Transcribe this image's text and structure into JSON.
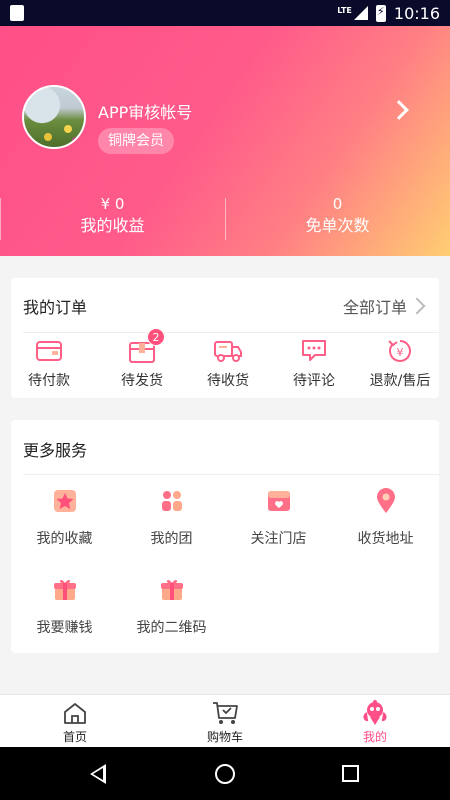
{
  "status_bar": {
    "network": "LTE",
    "time": "10:16"
  },
  "profile": {
    "username": "APP审核帐号",
    "member_level": "铜牌会员"
  },
  "stats": [
    {
      "value": "¥ 0",
      "label": "我的收益"
    },
    {
      "value": "0",
      "label": "免单次数"
    }
  ],
  "orders": {
    "title": "我的订单",
    "all_label": "全部订单",
    "items": [
      {
        "label": "待付款",
        "icon": "wallet-icon"
      },
      {
        "label": "待发货",
        "icon": "package-icon",
        "badge": "2"
      },
      {
        "label": "待收货",
        "icon": "truck-icon"
      },
      {
        "label": "待评论",
        "icon": "comment-icon"
      },
      {
        "label": "退款/售后",
        "icon": "refund-icon"
      }
    ]
  },
  "services": {
    "title": "更多服务",
    "items": [
      {
        "label": "我的收藏",
        "icon": "star-icon"
      },
      {
        "label": "我的团",
        "icon": "group-icon"
      },
      {
        "label": "关注门店",
        "icon": "store-icon"
      },
      {
        "label": "收货地址",
        "icon": "location-icon"
      },
      {
        "label": "我要赚钱",
        "icon": "gift-icon"
      },
      {
        "label": "我的二维码",
        "icon": "gift-icon"
      }
    ]
  },
  "bottom_nav": [
    {
      "label": "首页",
      "icon": "home-icon"
    },
    {
      "label": "购物车",
      "icon": "cart-icon"
    },
    {
      "label": "我的",
      "icon": "mascot-icon",
      "active": true
    }
  ],
  "colors": {
    "accent": "#ff4f88",
    "gradient_end": "#ffce72"
  }
}
